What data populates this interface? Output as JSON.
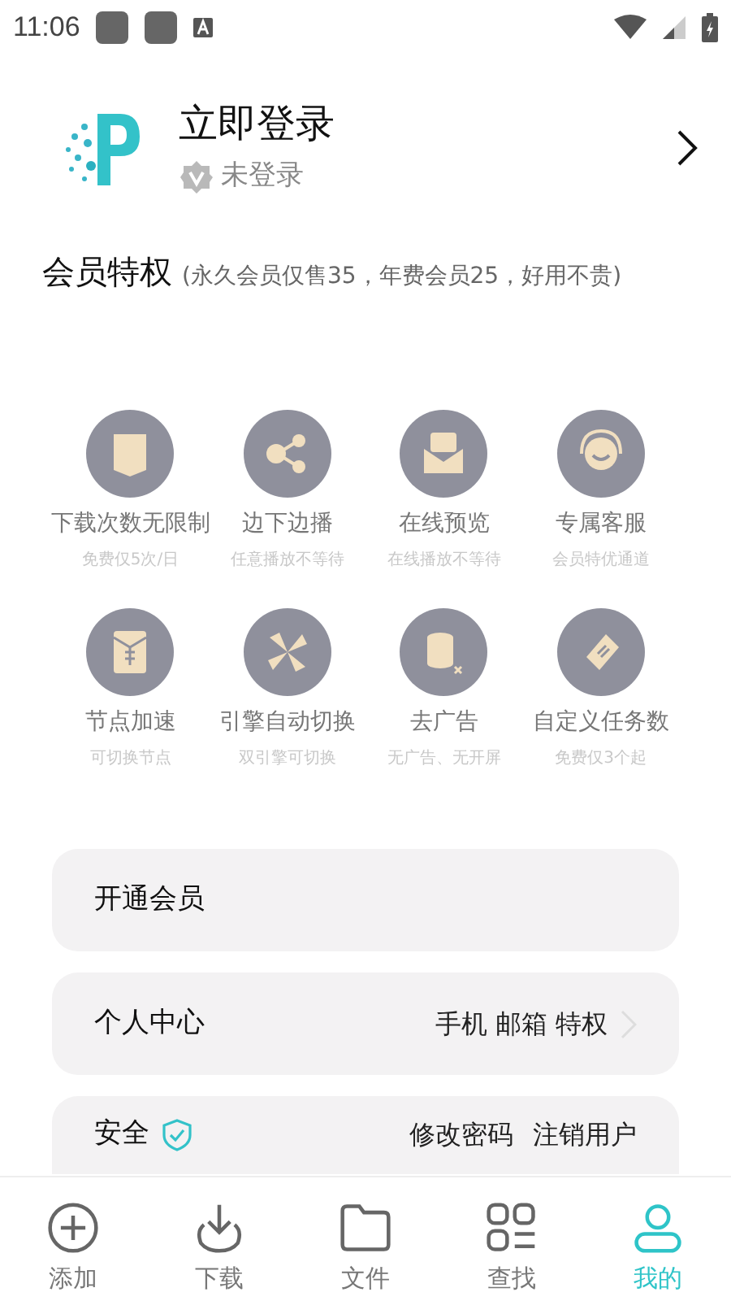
{
  "status_bar": {
    "time": "11:06"
  },
  "profile": {
    "title": "立即登录",
    "status": "未登录"
  },
  "benefits": {
    "title": "会员特权",
    "note": "(永久会员仅售35，年费会员25，好用不贵)",
    "items": [
      {
        "title": "下载次数无限制",
        "subtitle": "免费仅5次/日"
      },
      {
        "title": "边下边播",
        "subtitle": "任意播放不等待"
      },
      {
        "title": "在线预览",
        "subtitle": "在线播放不等待"
      },
      {
        "title": "专属客服",
        "subtitle": "会员特优通道"
      },
      {
        "title": "节点加速",
        "subtitle": "可切换节点"
      },
      {
        "title": "引擎自动切换",
        "subtitle": "双引擎可切换"
      },
      {
        "title": "去广告",
        "subtitle": "无广告、无开屏"
      },
      {
        "title": "自定义任务数",
        "subtitle": "免费仅3个起"
      }
    ]
  },
  "menu": [
    {
      "label": "开通会员"
    },
    {
      "label": "个人中心",
      "detail": "手机 邮箱 特权",
      "chevron": true
    },
    {
      "label": "安全",
      "verified": true,
      "actions": [
        "修改密码",
        "注销用户"
      ]
    }
  ],
  "bottom_nav": [
    {
      "label": "添加",
      "selected": false
    },
    {
      "label": "下载",
      "selected": false
    },
    {
      "label": "文件",
      "selected": false
    },
    {
      "label": "查找",
      "selected": false
    },
    {
      "label": "我的",
      "selected": true
    }
  ]
}
